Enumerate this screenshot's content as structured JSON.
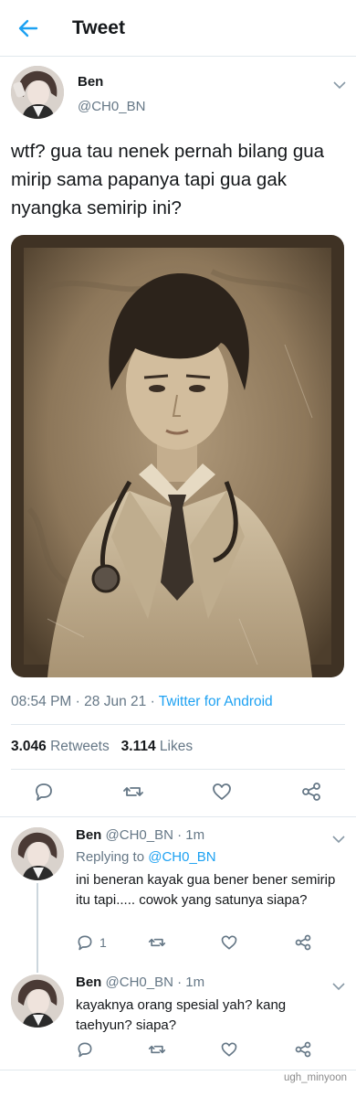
{
  "header": {
    "title": "Tweet",
    "back_icon": "back-arrow-icon"
  },
  "tweet": {
    "name": "Ben",
    "handle": "@CH0_BN",
    "text": "wtf? gua tau nenek pernah bilang gua mirip sama papanya tapi gua gak nyangka semirip ini?",
    "time": "08:54 PM",
    "date": "28 Jun 21",
    "sep": "·",
    "source": "Twitter for Android",
    "retweets_count": "3.046",
    "retweets_label": "Retweets",
    "likes_count": "3.114",
    "likes_label": "Likes"
  },
  "replies": [
    {
      "name": "Ben",
      "handle": "@CH0_BN",
      "age": "· 1m",
      "replying_label": "Replying to",
      "replying_to": "@CH0_BN",
      "text": "ini beneran kayak gua bener bener semirip itu tapi..... cowok yang satunya siapa?",
      "reply_count": "1"
    },
    {
      "name": "Ben",
      "handle": "@CH0_BN",
      "age": "· 1m",
      "text": "kayaknya orang spesial yah? kang taehyun? siapa?"
    }
  ],
  "watermark": "ugh_minyoon",
  "colors": {
    "accent": "#1da1f2",
    "muted": "#657786",
    "divider": "#e1e8ed"
  }
}
